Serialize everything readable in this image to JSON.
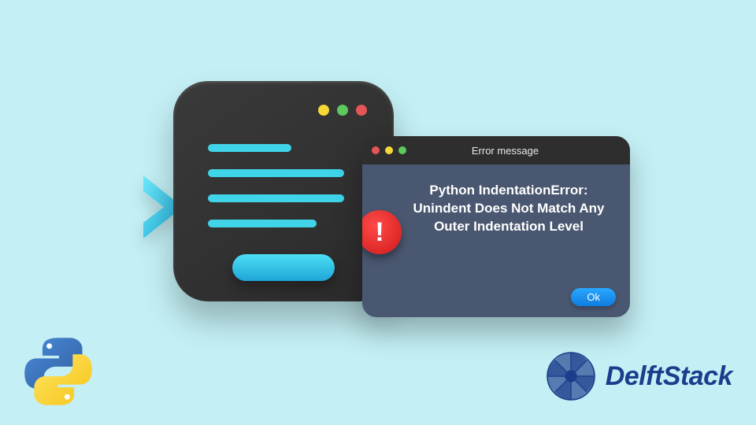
{
  "dialog": {
    "titlebar_label": "Error message",
    "message": "Python IndentationError: Unindent Does Not Match Any Outer Indentation Level",
    "alert_glyph": "!",
    "ok_label": "Ok"
  },
  "branding": {
    "delftstack_text": "DelftStack"
  },
  "colors": {
    "background": "#c4f0f5",
    "dialog_body": "#4a5770",
    "ok_button": "#1188ee",
    "accent_cyan": "#3fd4e8",
    "brand_blue": "#1a3e8c"
  }
}
